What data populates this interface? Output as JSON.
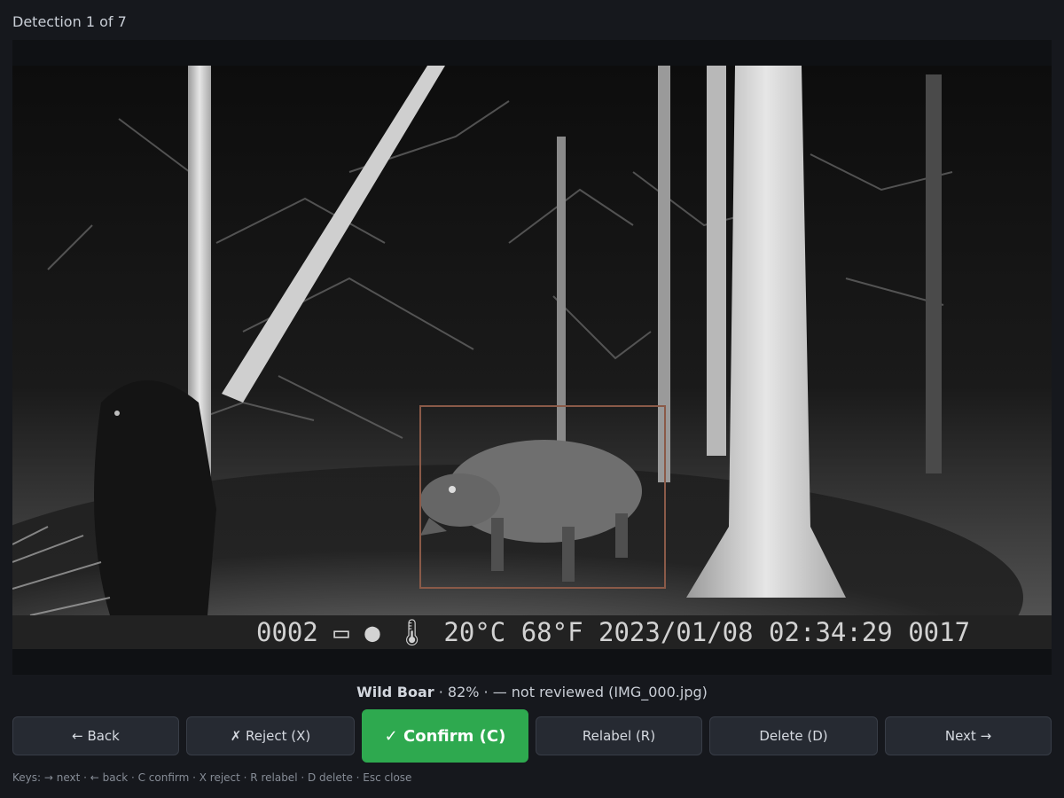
{
  "header": {
    "title": "Detection 1 of 7"
  },
  "photo": {
    "overlay_text": "0002 ▭ ● 🌡 20°C 68°F 2023/01/08 02:34:29 0017",
    "overlay": {
      "frame": "0002",
      "battery_icon": "battery-icon",
      "moon_icon": "moon-icon",
      "thermometer_icon": "thermometer-icon",
      "temp_c": "20°C",
      "temp_f": "68°F",
      "date": "2023/01/08",
      "time": "02:34:29",
      "counter": "0017"
    },
    "bbox_color": "#8a5a48"
  },
  "caption": {
    "species": "Wild Boar",
    "details": " · 82% · — not reviewed (IMG_000.jpg)"
  },
  "buttons": {
    "back": "← Back",
    "reject": "✗ Reject (X)",
    "confirm": "✓ Confirm (C)",
    "relabel": "Relabel (R)",
    "delete": "Delete (D)",
    "next": "Next →"
  },
  "keys_hint": "Keys:  → next · ← back · C confirm · X reject · R relabel · D delete · Esc close",
  "colors": {
    "background": "#16181d",
    "button_bg": "#262a32",
    "confirm_bg": "#2ea94f"
  }
}
